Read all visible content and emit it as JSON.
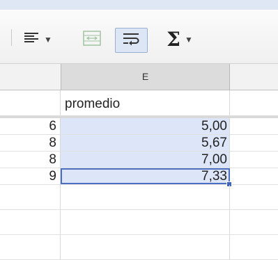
{
  "toolbar": {
    "align_icon": "align-left-icon",
    "merge_icon": "merge-cells-icon",
    "wrap_icon": "wrap-text-icon",
    "sum_symbol": "Σ",
    "dropdown_caret": "▼"
  },
  "column_header": {
    "label": "E"
  },
  "sheet": {
    "header_row": {
      "d": "",
      "e": "promedio"
    },
    "rows": [
      {
        "d": "6",
        "e": "5,00"
      },
      {
        "d": "8",
        "e": "5,67"
      },
      {
        "d": "8",
        "e": "7,00"
      },
      {
        "d": "9",
        "e": "7,33"
      }
    ]
  },
  "colors": {
    "selection_fill": "#dde5f8",
    "active_border": "#4a6fc2"
  }
}
